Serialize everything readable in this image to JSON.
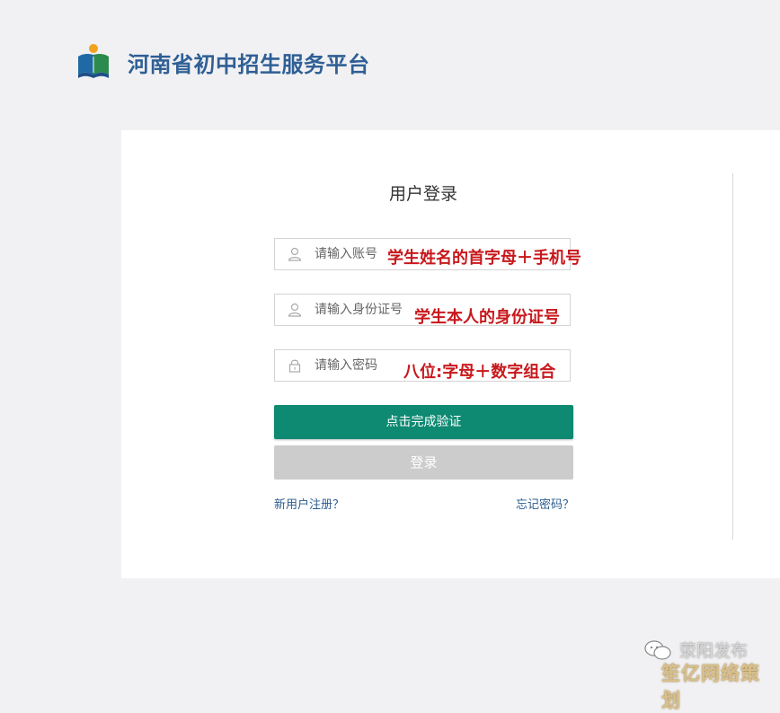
{
  "header": {
    "site_title": "河南省初中招生服务平台",
    "logo": "book-person-logo"
  },
  "login": {
    "title": "用户登录",
    "account_placeholder": "请输入账号",
    "id_placeholder": "请输入身份证号",
    "password_placeholder": "请输入密码",
    "verify_button": "点击完成验证",
    "login_button": "登录",
    "register_link": "新用户注册？",
    "forgot_link": "忘记密码？"
  },
  "annotations": {
    "account_hint": "学生姓名的首字母＋手机号",
    "id_hint": "学生本人的身份证号",
    "password_hint": "八位:字母＋数字组合"
  },
  "watermark": {
    "name": "荥阳发布",
    "sub": "笙亿网络策划"
  },
  "colors": {
    "title_blue": "#2f5f95",
    "verify_green": "#0e8a72",
    "disabled_gray": "#cccccc",
    "annotation_red": "#c8181c"
  },
  "icons": {
    "account": "user-icon",
    "id": "user-icon",
    "password": "lock-icon",
    "watermark": "chat-bubble-icon"
  }
}
